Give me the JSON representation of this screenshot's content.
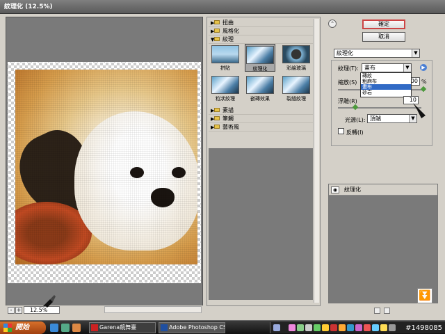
{
  "window": {
    "title": "紋理化 (12.5%)"
  },
  "preview": {
    "zoom": "12.5%",
    "zoom_minus": "-",
    "zoom_plus": "+"
  },
  "gallery": {
    "categories": [
      {
        "label": "扭曲",
        "expanded": false
      },
      {
        "label": "風格化",
        "expanded": false
      },
      {
        "label": "紋理",
        "expanded": true
      },
      {
        "label": "素描",
        "expanded": false
      },
      {
        "label": "筆觸",
        "expanded": false
      },
      {
        "label": "藝術風",
        "expanded": false
      }
    ],
    "texture_filters": [
      {
        "label": "拼貼",
        "selected": false
      },
      {
        "label": "紋理化",
        "selected": true
      },
      {
        "label": "彩繪玻璃",
        "selected": false
      },
      {
        "label": "粒狀紋理",
        "selected": false
      },
      {
        "label": "嵌磚效果",
        "selected": false
      },
      {
        "label": "裂縫紋理",
        "selected": false
      }
    ]
  },
  "buttons": {
    "ok": "確定",
    "cancel": "取消"
  },
  "filter_select": {
    "value": "紋理化"
  },
  "settings": {
    "texture_label": "紋理(T):",
    "texture_value": "畫布",
    "texture_options": [
      "磚紋",
      "粗麻布",
      "畫布",
      "砂岩"
    ],
    "texture_highlight": "畫布",
    "scaling_label": "縮放(S)",
    "scaling_value": "100",
    "scaling_unit": "%",
    "relief_label": "浮雕(R)",
    "relief_value": "10",
    "light_label": "光源(L):",
    "light_value": "頂端",
    "invert_label": "反轉(I)",
    "invert_checked": false
  },
  "layers": {
    "items": [
      {
        "label": "紋理化",
        "visible": true
      }
    ]
  },
  "taskbar": {
    "start_label": "開始",
    "tasks": [
      {
        "label": "Garena競舞臺",
        "active": false
      },
      {
        "label": "Adobe Photoshop CS...",
        "active": true
      }
    ],
    "watermark": "#1498085"
  }
}
